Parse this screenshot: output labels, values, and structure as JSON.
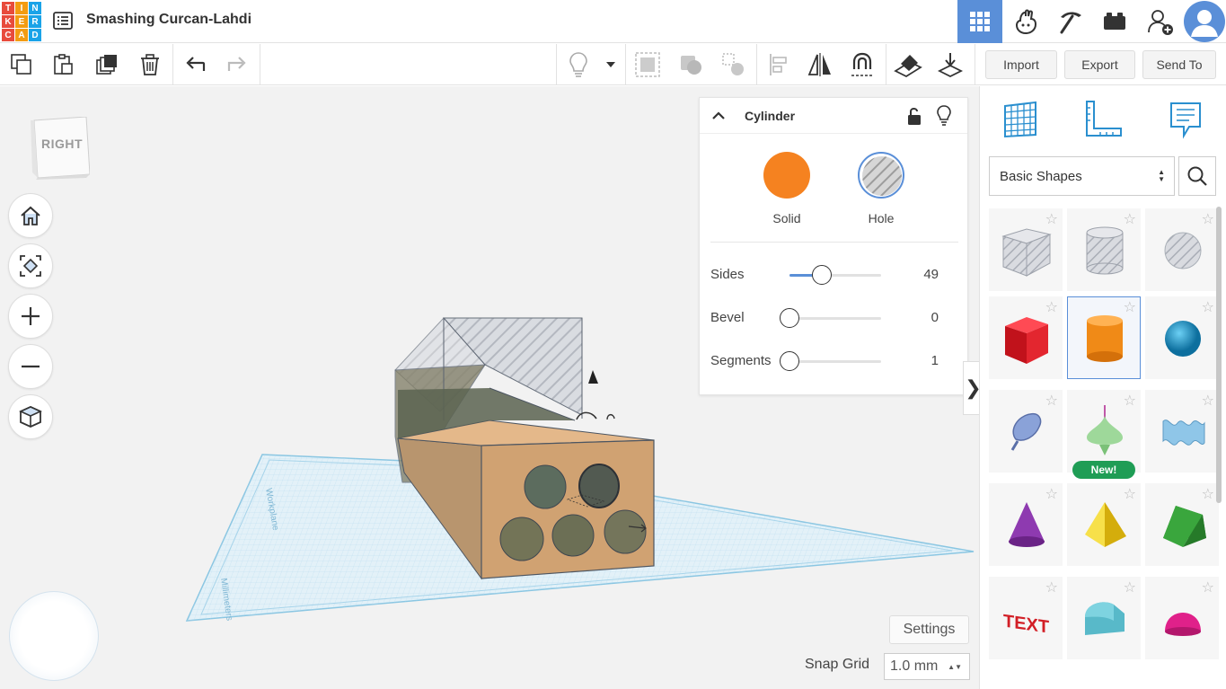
{
  "app": {
    "logo_letters": [
      "T",
      "I",
      "N",
      "K",
      "E",
      "R",
      "C",
      "A",
      "D"
    ],
    "logo_colors": [
      "#e84b3c",
      "#f39c12",
      "#1aa3e8",
      "#e84b3c",
      "#f39c12",
      "#1aa3e8",
      "#e84b3c",
      "#f39c12",
      "#1aa3e8"
    ],
    "project_title": "Smashing Curcan-Lahdi",
    "accent_color": "#5a8fd8"
  },
  "top_right": {
    "items": [
      "grid-view-icon",
      "tinker-hand-icon",
      "pickaxe-icon",
      "bricks-icon",
      "add-user-icon",
      "avatar-icon"
    ]
  },
  "toolbar": {
    "left_tools": [
      "copy-icon",
      "paste-icon",
      "duplicate-icon",
      "delete-icon",
      "undo-icon",
      "redo-icon"
    ],
    "right_tools": [
      "light-bulb-icon",
      "dropdown-icon",
      "group-icon",
      "ungroup-icon",
      "hole-solid-icon",
      "align-icon",
      "mirror-icon",
      "magnet-icon",
      "workplane-icon",
      "drop-icon"
    ],
    "import_label": "Import",
    "export_label": "Export",
    "send_to_label": "Send To"
  },
  "viewport": {
    "view_cube_label": "RIGHT",
    "nav_buttons": [
      "home-icon",
      "fit-view-icon",
      "zoom-in-icon",
      "zoom-out-icon",
      "perspective-icon"
    ],
    "workplane_label_top": "Workplane",
    "workplane_label_bottom": "Millimeters",
    "settings_label": "Settings",
    "snap_grid_label": "Snap Grid",
    "snap_grid_value": "1.0 mm"
  },
  "inspector": {
    "title": "Cylinder",
    "solid_label": "Solid",
    "hole_label": "Hole",
    "solid_color": "#f58220",
    "sliders": [
      {
        "label": "Sides",
        "value": "49",
        "fraction": 0.35
      },
      {
        "label": "Bevel",
        "value": "0",
        "fraction": 0
      },
      {
        "label": "Segments",
        "value": "1",
        "fraction": 0
      }
    ]
  },
  "shapes_panel": {
    "tabs": [
      "workplane-grid-icon",
      "ruler-icon",
      "notes-icon"
    ],
    "category": "Basic Shapes",
    "new_badge": "New!",
    "shapes": [
      {
        "name": "Box Hole",
        "color": "#c9c9cf"
      },
      {
        "name": "Cylinder Hole",
        "color": "#c9c9cf"
      },
      {
        "name": "Sphere Hole",
        "color": "#c9c9cf"
      },
      {
        "name": "Box",
        "color": "#e3262f"
      },
      {
        "name": "Cylinder",
        "color": "#f08a17"
      },
      {
        "name": "Sphere",
        "color": "#1d94c8"
      },
      {
        "name": "Scribble",
        "color": "#8aa2d8"
      },
      {
        "name": "Shape Generator",
        "color": "#9ed89a"
      },
      {
        "name": "Text Wave",
        "color": "#8fc6e8"
      },
      {
        "name": "Cone",
        "color": "#8e3ab0"
      },
      {
        "name": "Pyramid",
        "color": "#f2cf1c"
      },
      {
        "name": "Roof",
        "color": "#3aa63d"
      },
      {
        "name": "Text",
        "color": "#d21f26"
      },
      {
        "name": "Half Cylinder",
        "color": "#58b9c9"
      },
      {
        "name": "Paraboloid",
        "color": "#e0218a"
      }
    ]
  }
}
